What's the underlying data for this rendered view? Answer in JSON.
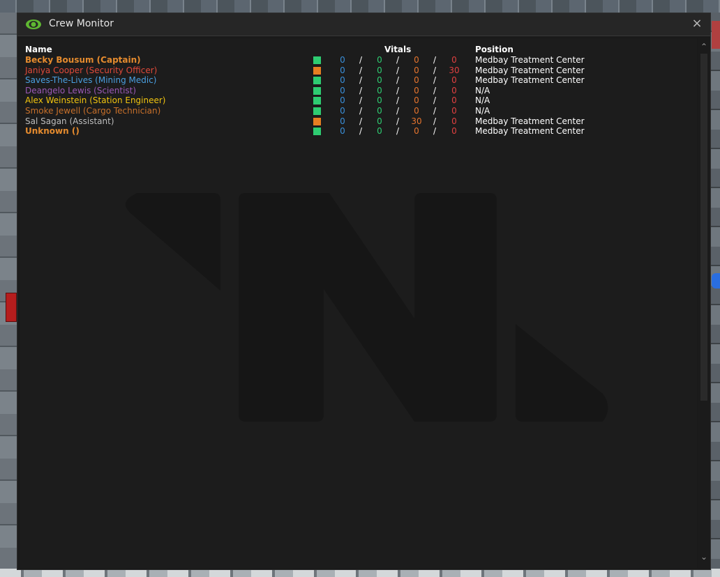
{
  "window": {
    "title": "Crew Monitor",
    "close_label": "×",
    "title_icon": "eye-icon"
  },
  "table": {
    "headers": {
      "name": "Name",
      "vitals": "Vitals",
      "position": "Position"
    },
    "separator": "/",
    "rows": [
      {
        "name": "Becky Bousum (Captain)",
        "name_color": "#e58b2e",
        "bold": true,
        "status_color": "#2ecc71",
        "vitals": [
          "0",
          "0",
          "0",
          "0"
        ],
        "vital_colors": [
          "#3a8fd9",
          "#2ecc71",
          "#e5742e",
          "#e04040"
        ],
        "position": "Medbay Treatment Center"
      },
      {
        "name": "Janiya Cooper (Security Officer)",
        "name_color": "#e04a3a",
        "bold": false,
        "status_color": "#e67e22",
        "vitals": [
          "0",
          "0",
          "0",
          "30"
        ],
        "vital_colors": [
          "#3a8fd9",
          "#2ecc71",
          "#e5742e",
          "#e04040"
        ],
        "position": "Medbay Treatment Center"
      },
      {
        "name": "Saves-The-Lives (Mining Medic)",
        "name_color": "#4a9fe0",
        "bold": false,
        "status_color": "#2ecc71",
        "vitals": [
          "0",
          "0",
          "0",
          "0"
        ],
        "vital_colors": [
          "#3a8fd9",
          "#2ecc71",
          "#e5742e",
          "#e04040"
        ],
        "position": "Medbay Treatment Center"
      },
      {
        "name": "Deangelo Lewis (Scientist)",
        "name_color": "#9b59b6",
        "bold": false,
        "status_color": "#2ecc71",
        "vitals": [
          "0",
          "0",
          "0",
          "0"
        ],
        "vital_colors": [
          "#3a8fd9",
          "#2ecc71",
          "#e5742e",
          "#e04040"
        ],
        "position": "N/A"
      },
      {
        "name": "Alex Weinstein (Station Engineer)",
        "name_color": "#f1c40f",
        "bold": false,
        "status_color": "#2ecc71",
        "vitals": [
          "0",
          "0",
          "0",
          "0"
        ],
        "vital_colors": [
          "#3a8fd9",
          "#2ecc71",
          "#e5742e",
          "#e04040"
        ],
        "position": "N/A"
      },
      {
        "name": "Smoke Jewell (Cargo Technician)",
        "name_color": "#c8702a",
        "bold": false,
        "status_color": "#2ecc71",
        "vitals": [
          "0",
          "0",
          "0",
          "0"
        ],
        "vital_colors": [
          "#3a8fd9",
          "#2ecc71",
          "#e5742e",
          "#e04040"
        ],
        "position": "N/A"
      },
      {
        "name": "Sal Sagan (Assistant)",
        "name_color": "#bdbdbd",
        "bold": false,
        "status_color": "#e67e22",
        "vitals": [
          "0",
          "0",
          "30",
          "0"
        ],
        "vital_colors": [
          "#3a8fd9",
          "#2ecc71",
          "#e5742e",
          "#e04040"
        ],
        "position": "Medbay Treatment Center"
      },
      {
        "name": "Unknown ()",
        "name_color": "#e58b2e",
        "bold": true,
        "status_color": "#2ecc71",
        "vitals": [
          "0",
          "0",
          "0",
          "0"
        ],
        "vital_colors": [
          "#3a8fd9",
          "#2ecc71",
          "#e5742e",
          "#e04040"
        ],
        "position": "Medbay Treatment Center"
      }
    ]
  },
  "scrollbar": {
    "up_icon": "chevron-up-icon",
    "down_icon": "chevron-down-icon"
  },
  "colors": {
    "window_bg": "#1a1a1a",
    "titlebar_bg": "#262626",
    "accent_eye": "#5fb832"
  }
}
